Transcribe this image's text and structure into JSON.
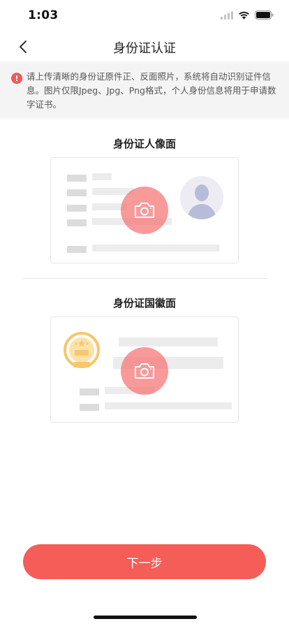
{
  "status_bar": {
    "time": "1:03"
  },
  "nav": {
    "title": "身份证认证"
  },
  "notice": {
    "icon": "info-icon",
    "icon_glyph": "!",
    "text": "请上传清晰的身份证原件正、反面照片，系统将自动识别证件信息。图片仅限Jpeg、Jpg、Png格式，个人身份信息将用于申请数字证书。"
  },
  "front": {
    "title": "身份证人像面"
  },
  "back": {
    "title": "身份证国徽面"
  },
  "footer": {
    "next_label": "下一步"
  },
  "colors": {
    "accent": "#f55d59",
    "camera": "#f67878",
    "avatar": "#b7bcd9",
    "emblem": "#f8c66e"
  }
}
